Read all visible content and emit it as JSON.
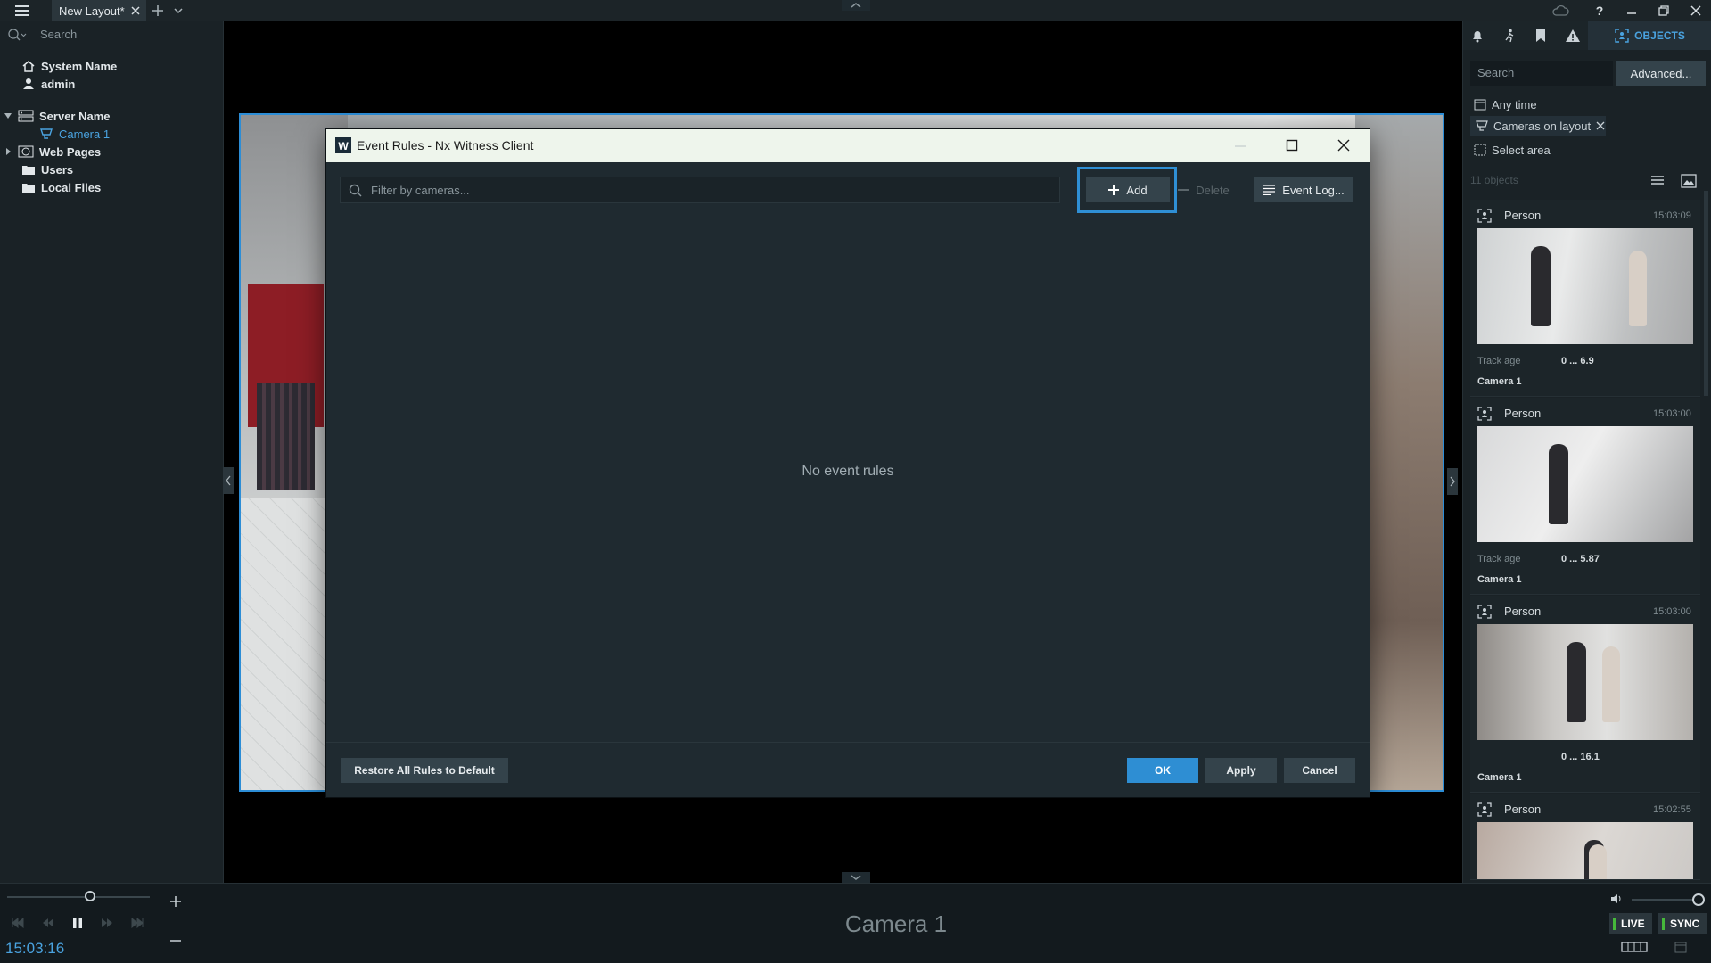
{
  "titlebar": {
    "tab_label": "New Layout*",
    "icons": [
      "menu-icon",
      "close-tab-icon",
      "add-tab-icon",
      "chevron-down-icon",
      "cloud-icon",
      "help-icon",
      "minimize-icon",
      "restore-icon",
      "close-icon"
    ]
  },
  "left_panel": {
    "search_placeholder": "Search",
    "system_name": "System Name",
    "user": "admin",
    "server": "Server Name",
    "camera": "Camera 1",
    "web_pages": "Web Pages",
    "users": "Users",
    "local_files": "Local Files"
  },
  "dialog": {
    "title": "Event Rules - Nx Witness Client",
    "app_icon_letter": "W",
    "filter_placeholder": "Filter by cameras...",
    "add_label": "Add",
    "delete_label": "Delete",
    "event_log_label": "Event Log...",
    "empty_message": "No event rules",
    "restore_label": "Restore All Rules to Default",
    "ok_label": "OK",
    "apply_label": "Apply",
    "cancel_label": "Cancel"
  },
  "right_panel": {
    "tab_objects": "OBJECTS",
    "search_placeholder": "Search",
    "advanced_label": "Advanced...",
    "time_filter": "Any time",
    "camera_filter": "Cameras on layout",
    "area_filter": "Select area",
    "count": "11 objects",
    "cards": [
      {
        "type": "Person",
        "time": "15:03:09",
        "track_key": "Track age",
        "track_value": "0 ... 6.9",
        "camera": "Camera 1"
      },
      {
        "type": "Person",
        "time": "15:03:00",
        "track_key": "Track age",
        "track_value": "0 ... 5.87",
        "camera": "Camera 1"
      },
      {
        "type": "Person",
        "time": "15:03:00",
        "track_key": "",
        "track_value": "0 ... 16.1",
        "camera": "Camera 1"
      },
      {
        "type": "Person",
        "time": "15:02:55",
        "track_key": "",
        "track_value": "",
        "camera": ""
      }
    ]
  },
  "bottom": {
    "camera_label": "Camera 1",
    "clock": "15:03:16",
    "live_label": "LIVE",
    "sync_label": "SYNC"
  },
  "colors": {
    "accent": "#2e8ed3",
    "highlight": "#2f8fd5",
    "live_indicator": "#46b93b"
  }
}
